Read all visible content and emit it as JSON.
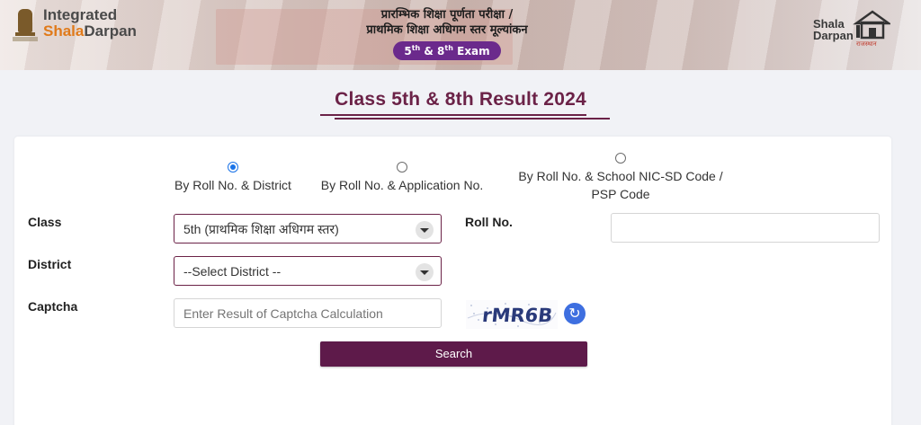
{
  "header": {
    "brand_line1": "Integrated",
    "brand_line2_prefix": "Shala",
    "brand_line2_suffix": "Darpan",
    "title_line1": "प्रारम्भिक शिक्षा पूर्णता परीक्षा /",
    "title_line2": "प्राथमिक शिक्षा अधिगम स्तर मूल्यांकन",
    "exam_badge_a": "5",
    "exam_badge_b": "th",
    "exam_badge_c": " & 8",
    "exam_badge_d": "th",
    "exam_badge_e": " Exam",
    "right_logo_word1": "Shala",
    "right_logo_word2": "Darpan",
    "right_logo_tag": "राजस्थान"
  },
  "page": {
    "title": "Class 5th & 8th Result 2024"
  },
  "search_options": [
    {
      "label": "By Roll No. & District",
      "checked": true
    },
    {
      "label": "By Roll No. & Application No.",
      "checked": false
    },
    {
      "label_line1": "By Roll No. & School NIC-SD Code /",
      "label_line2": "PSP Code",
      "checked": false
    }
  ],
  "form": {
    "class_label": "Class",
    "class_value": "5th (प्राथमिक शिक्षा अधिगम स्तर)",
    "roll_label": "Roll No.",
    "roll_value": "",
    "district_label": "District",
    "district_value": "--Select District --",
    "captcha_label": "Captcha",
    "captcha_placeholder": "Enter Result of Captcha Calculation",
    "captcha_text": "rMR6B",
    "search_label": "Search"
  },
  "colors": {
    "accent": "#6b2247",
    "button": "#5e1a4a",
    "exam_badge": "#6b2a8c",
    "radio_checked": "#1a73e8",
    "refresh_button": "#3e6fe0"
  },
  "icons": {
    "refresh": "refresh-icon",
    "dropdown": "chevron-down-icon"
  }
}
